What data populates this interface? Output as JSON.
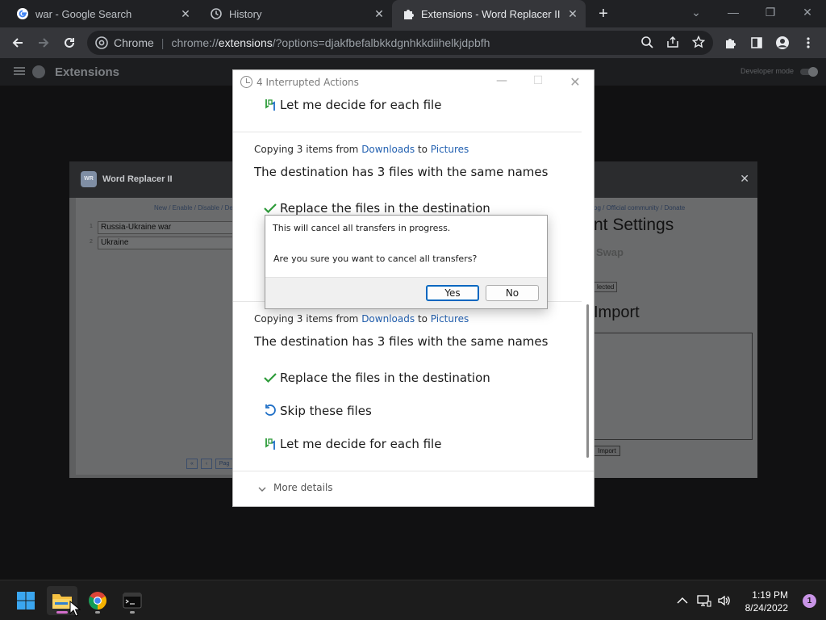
{
  "browser": {
    "tabs": [
      {
        "title": "war - Google Search",
        "icon": "google-icon"
      },
      {
        "title": "History",
        "icon": "history-icon"
      },
      {
        "title": "Extensions - Word Replacer II",
        "icon": "puzzle-icon",
        "active": true
      }
    ],
    "omnibox": {
      "chip_label": "Chrome",
      "url_scheme": "chrome://",
      "url_host": "extensions",
      "url_rest": "/?options=djakfbefalbkkdgnhkkdiihelkjdpbfh"
    }
  },
  "extensions_page": {
    "title": "Extensions",
    "dev_mode_label": "Developer mode"
  },
  "word_replacer": {
    "title": "Word Replacer II",
    "logo_text": "WR",
    "left_links": "New / Enable / Disable / De",
    "rows": [
      {
        "num": "1",
        "value": "Russia-Ukraine war"
      },
      {
        "num": "2",
        "value": "Ukraine"
      }
    ],
    "pager": [
      "«",
      "‹",
      "Pag"
    ],
    "right_links": "og / Official community / Donate",
    "settings_heading": "nt Settings",
    "swap_label": "Swap",
    "selected_label": "lected",
    "import_heading": "Import",
    "import_button": "Import"
  },
  "interrupted_actions": {
    "title": "4 Interrupted Actions",
    "group1": {
      "option_decide": "Let me decide for each file"
    },
    "group2": {
      "copying_prefix": "Copying 3 items from ",
      "from": "Downloads",
      "to_word": " to ",
      "to": "Pictures",
      "destination": "The destination has 3 files with the same names",
      "option_replace": "Replace the files in the destination"
    },
    "group3": {
      "copying_prefix": "Copying 3 items from ",
      "from": "Downloads",
      "to_word": " to ",
      "to": "Pictures",
      "destination": "The destination has 3 files with the same names",
      "option_replace": "Replace the files in the destination",
      "option_skip": "Skip these files",
      "option_decide": "Let me decide for each file"
    },
    "more_details": "More details"
  },
  "confirm_dialog": {
    "message": "This will cancel all transfers in progress.",
    "question": "Are you sure you want to cancel all transfers?",
    "yes": "Yes",
    "no": "No"
  },
  "taskbar": {
    "time": "1:19 PM",
    "date": "8/24/2022",
    "notification_count": "1"
  },
  "colors": {
    "link": "#2361b1",
    "check": "#2e9c3a",
    "accent": "#0067c0"
  }
}
